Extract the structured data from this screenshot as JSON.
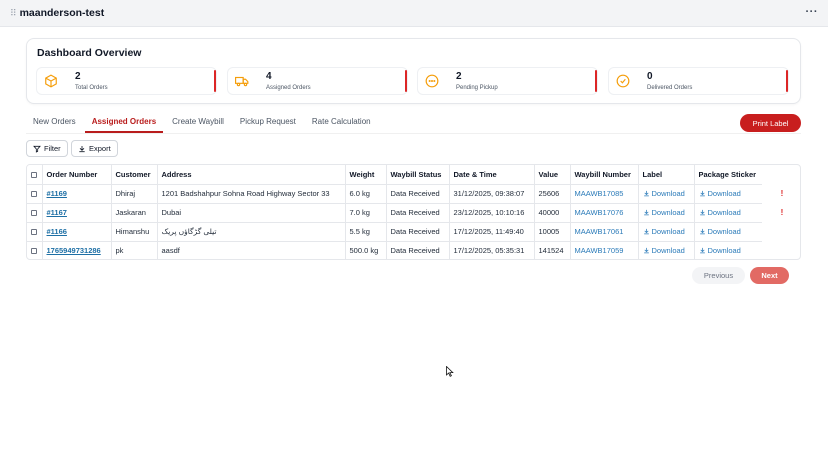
{
  "window": {
    "title": "maanderson-test",
    "more_label": "···"
  },
  "overview": {
    "title": "Dashboard Overview",
    "cards": [
      {
        "value": "2",
        "label": "Total Orders",
        "icon": "box-icon"
      },
      {
        "value": "4",
        "label": "Assigned Orders",
        "icon": "truck-icon"
      },
      {
        "value": "2",
        "label": "Pending Pickup",
        "icon": "pending-icon"
      },
      {
        "value": "0",
        "label": "Delivered Orders",
        "icon": "check-circle-icon"
      }
    ]
  },
  "tabs": [
    "New Orders",
    "Assigned Orders",
    "Create Waybill",
    "Pickup Request",
    "Rate Calculation"
  ],
  "active_tab": "Assigned Orders",
  "actions": {
    "print_label": "Print Label",
    "filter": "Filter",
    "export": "Export"
  },
  "table": {
    "headers": [
      "Order Number",
      "Customer",
      "Address",
      "Weight",
      "Waybill Status",
      "Date & Time",
      "Value",
      "Waybill Number",
      "Label",
      "Package Sticker"
    ],
    "rows": [
      {
        "order": "#1169",
        "customer": "Dhiraj",
        "address": "1201 Badshahpur Sohna Road Highway Sector 33",
        "weight": "6.0 kg",
        "status": "Data Received",
        "datetime": "31/12/2025, 09:38:07",
        "value": "25606",
        "waybill": "MAAWB17085",
        "label": "Download",
        "sticker": "Download",
        "alert": "!"
      },
      {
        "order": "#1167",
        "customer": "Jaskaran",
        "address": "Dubai",
        "weight": "7.0 kg",
        "status": "Data Received",
        "datetime": "23/12/2025, 10:10:16",
        "value": "40000",
        "waybill": "MAAWB17076",
        "label": "Download",
        "sticker": "Download",
        "alert": "!"
      },
      {
        "order": "#1166",
        "customer": "Himanshu",
        "address": "تیلی گڑگاؤں پریک",
        "weight": "5.5 kg",
        "status": "Data Received",
        "datetime": "17/12/2025, 11:49:40",
        "value": "10005",
        "waybill": "MAAWB17061",
        "label": "Download",
        "sticker": "Download",
        "alert": ""
      },
      {
        "order": "1765949731286",
        "customer": "pk",
        "address": "aasdf",
        "weight": "500.0 kg",
        "status": "Data Received",
        "datetime": "17/12/2025, 05:35:31",
        "value": "141524",
        "waybill": "MAAWB17059",
        "label": "Download",
        "sticker": "Download",
        "alert": ""
      }
    ]
  },
  "pagination": {
    "previous": "Previous",
    "next": "Next"
  },
  "colors": {
    "accent": "#c81e1e",
    "link": "#2b7bb9",
    "icon": "#f59e0b"
  }
}
